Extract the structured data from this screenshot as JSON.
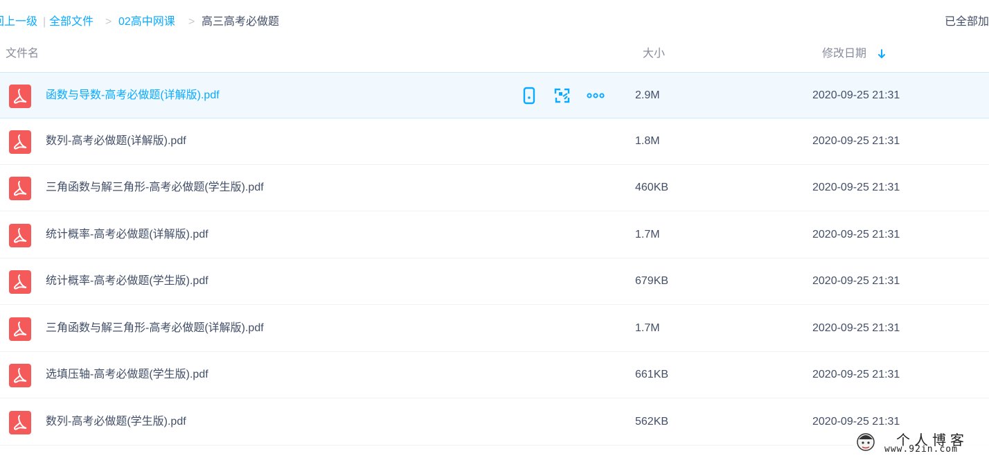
{
  "breadcrumb": {
    "back": "回上一级",
    "separator": "|",
    "all_files": "全部文件",
    "chevron": ">",
    "folder": "02高中网课",
    "current": "高三高考必做题",
    "loaded_status": "已全部加载"
  },
  "columns": {
    "name": "文件名",
    "size": "大小",
    "modified": "修改日期"
  },
  "files": [
    {
      "name": "函数与导数-高考必做题(详解版).pdf",
      "size": "2.9M",
      "date": "2020-09-25 21:31"
    },
    {
      "name": "数列-高考必做题(详解版).pdf",
      "size": "1.8M",
      "date": "2020-09-25 21:31"
    },
    {
      "name": "三角函数与解三角形-高考必做题(学生版).pdf",
      "size": "460KB",
      "date": "2020-09-25 21:31"
    },
    {
      "name": "统计概率-高考必做题(详解版).pdf",
      "size": "1.7M",
      "date": "2020-09-25 21:31"
    },
    {
      "name": "统计概率-高考必做题(学生版).pdf",
      "size": "679KB",
      "date": "2020-09-25 21:31"
    },
    {
      "name": "三角函数与解三角形-高考必做题(详解版).pdf",
      "size": "1.7M",
      "date": "2020-09-25 21:31"
    },
    {
      "name": "选填压轴-高考必做题(学生版).pdf",
      "size": "661KB",
      "date": "2020-09-25 21:31"
    },
    {
      "name": "数列-高考必做题(学生版).pdf",
      "size": "562KB",
      "date": "2020-09-25 21:31"
    }
  ],
  "row_actions": [
    "phone-icon",
    "share-icon",
    "more-icon"
  ],
  "watermark": {
    "title": "个人博客",
    "url": "www.92in.com"
  },
  "colors": {
    "accent": "#09aaff",
    "pdf_red": "#f55a5a",
    "hover_row": "#f1f9ff"
  }
}
